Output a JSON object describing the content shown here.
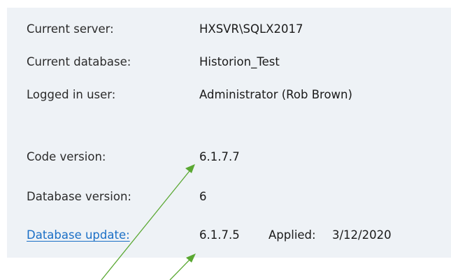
{
  "rows": [
    {
      "label": "Current server:",
      "value": "HXSVR\\SQLX2017"
    },
    {
      "label": "Current database:",
      "value": "Historion_Test"
    },
    {
      "label": "Logged in user:",
      "value": "Administrator (Rob Brown)"
    },
    {
      "label": "Code version:",
      "value": "6.1.7.7"
    },
    {
      "label": "Database version:",
      "value": "6"
    },
    {
      "label": "Database update:",
      "value": "6.1.7.5",
      "applied_label": "Applied:",
      "applied_date": "3/12/2020"
    }
  ],
  "colors": {
    "panel_background": "#eef2f6",
    "link": "#1a6fc6",
    "annotation_arrow": "#5aa832"
  }
}
